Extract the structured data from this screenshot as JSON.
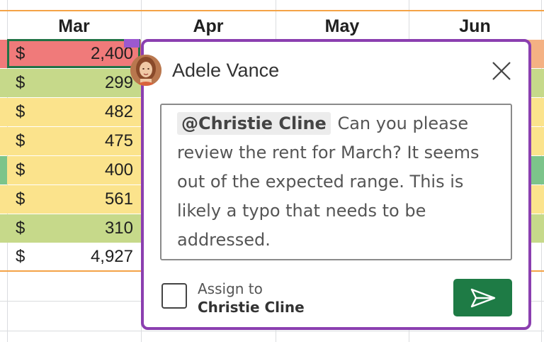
{
  "columns": [
    "Mar",
    "Apr",
    "May",
    "Jun"
  ],
  "currency_symbol": "$",
  "mar_values": [
    {
      "value": "2,400",
      "color": "#f07a7a"
    },
    {
      "value": "299",
      "color": "#c6d98a"
    },
    {
      "value": "482",
      "color": "#fbe38c"
    },
    {
      "value": "475",
      "color": "#fbe38c"
    },
    {
      "value": "400",
      "color": "#fbe38c"
    },
    {
      "value": "561",
      "color": "#fbe38c"
    },
    {
      "value": "310",
      "color": "#c6d98a"
    },
    {
      "value": "4,927",
      "color": "#ffffff"
    }
  ],
  "comment": {
    "author": "Adele Vance",
    "mention": "@Christie Cline",
    "text": "Can you please review the rent for March? It seems out of the expected range. This is likely a typo that needs to be addressed.",
    "assign_label": "Assign to",
    "assign_name": "Christie Cline",
    "border_color": "#8b3fb0",
    "send_color": "#1e7b45"
  }
}
